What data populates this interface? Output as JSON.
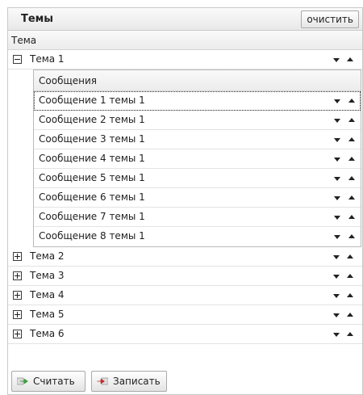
{
  "panel": {
    "title": "Темы",
    "clear_label": "очистить"
  },
  "grid": {
    "column_header": "Тема"
  },
  "topics": [
    {
      "label": "Тема 1",
      "expanded": true,
      "detail_header": "Сообщения",
      "messages": [
        "Сообщение 1 темы 1",
        "Сообщение 2 темы 1",
        "Сообщение 3 темы 1",
        "Сообщение 4 темы 1",
        "Сообщение 5 темы 1",
        "Сообщение 6 темы 1",
        "Сообщение 7 темы 1",
        "Сообщение 8 темы 1"
      ]
    },
    {
      "label": "Тема 2",
      "expanded": false
    },
    {
      "label": "Тема 3",
      "expanded": false
    },
    {
      "label": "Тема 4",
      "expanded": false
    },
    {
      "label": "Тема 5",
      "expanded": false
    },
    {
      "label": "Тема 6",
      "expanded": false
    }
  ],
  "buttons": {
    "read_label": "Считать",
    "write_label": "Записать"
  },
  "icons": {
    "row_move_down": "arrow-down-icon",
    "row_move_up": "arrow-up-icon",
    "read": "green-arrow-icon",
    "write": "red-arrow-icon"
  },
  "colors": {
    "read_icon": "#3aa63a",
    "write_icon": "#d62828"
  }
}
